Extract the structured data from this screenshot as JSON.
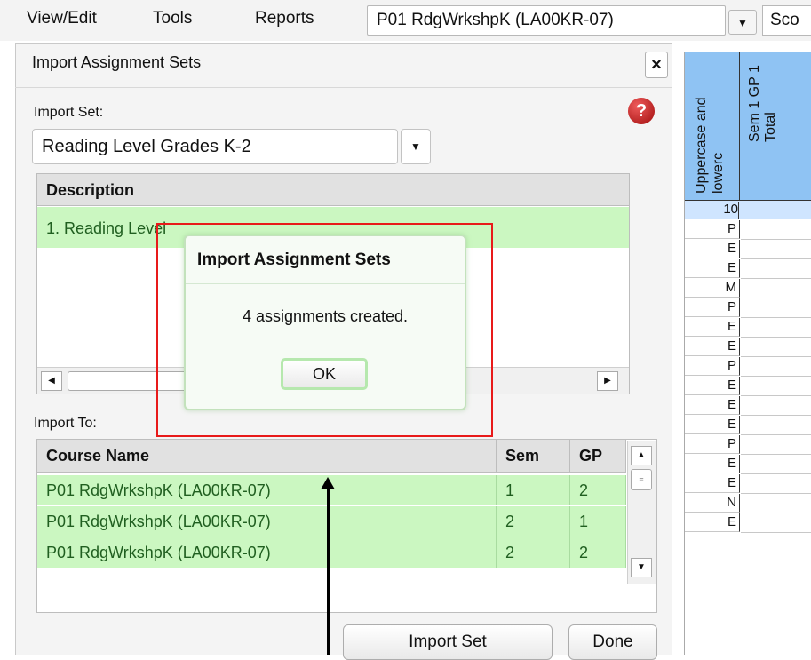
{
  "menubar": {
    "items": [
      "View/Edit",
      "Tools",
      "Reports"
    ],
    "course_selector": "P01  RdgWrkshpK (LA00KR-07)",
    "score_field": "Sco"
  },
  "dialog": {
    "title": "Import Assignment Sets",
    "import_set_label": "Import Set:",
    "import_set_value": "Reading Level Grades K-2",
    "description_header": "Description",
    "description_rows": [
      "1. Reading Level"
    ],
    "import_to_label": "Import To:",
    "course_columns": [
      "Course Name",
      "Sem",
      "GP"
    ],
    "course_rows": [
      {
        "name": "P01  RdgWrkshpK (LA00KR-07)",
        "sem": "1",
        "gp": "2"
      },
      {
        "name": "P01  RdgWrkshpK (LA00KR-07)",
        "sem": "2",
        "gp": "1"
      },
      {
        "name": "P01  RdgWrkshpK (LA00KR-07)",
        "sem": "2",
        "gp": "2"
      }
    ],
    "import_button": "Import Set",
    "done_button": "Done"
  },
  "popup": {
    "title": "Import Assignment Sets",
    "message": "4 assignments created.",
    "ok_label": "OK"
  },
  "gradebook": {
    "col1_header_line1": "Uppercase and",
    "col1_header_line2": "lowerc",
    "col2_header_line1": "Sem 1 GP 1",
    "col2_header_line2": "Total",
    "points": "10",
    "scores": [
      "P",
      "E",
      "E",
      "M",
      "P",
      "E",
      "E",
      "P",
      "E",
      "E",
      "E",
      "P",
      "E",
      "E",
      "N",
      "E"
    ]
  },
  "colors": {
    "selected_row": "#cbf7c1",
    "gradebook_header": "#8fc3f3",
    "annotation_frame": "#e81a1a"
  }
}
